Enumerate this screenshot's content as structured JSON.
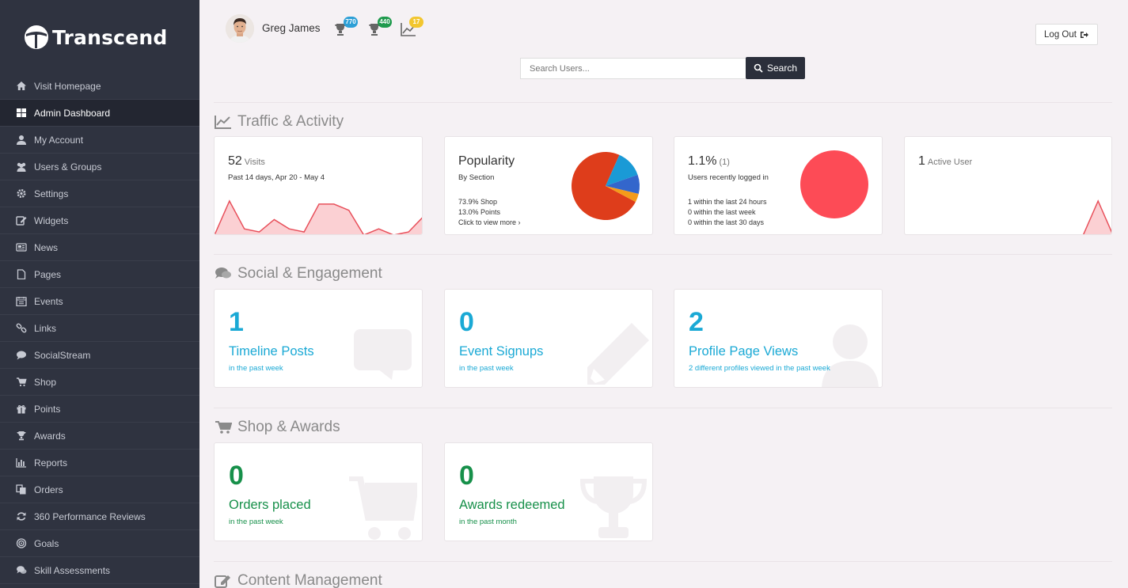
{
  "brand": {
    "name": "Transcend"
  },
  "sidebar": {
    "items": [
      {
        "label": "Visit Homepage",
        "icon": "home-icon"
      },
      {
        "label": "Admin Dashboard",
        "icon": "dashboard-icon",
        "active": true
      },
      {
        "label": "My Account",
        "icon": "user-icon"
      },
      {
        "label": "Users & Groups",
        "icon": "users-icon"
      },
      {
        "label": "Settings",
        "icon": "gear-icon"
      },
      {
        "label": "Widgets",
        "icon": "edit-icon"
      },
      {
        "label": "News",
        "icon": "newspaper-icon"
      },
      {
        "label": "Pages",
        "icon": "file-icon"
      },
      {
        "label": "Events",
        "icon": "calendar-icon"
      },
      {
        "label": "Links",
        "icon": "link-icon"
      },
      {
        "label": "SocialStream",
        "icon": "comment-icon"
      },
      {
        "label": "Shop",
        "icon": "cart-icon"
      },
      {
        "label": "Points",
        "icon": "gift-icon"
      },
      {
        "label": "Awards",
        "icon": "trophy-icon"
      },
      {
        "label": "Reports",
        "icon": "bar-chart-icon"
      },
      {
        "label": "Orders",
        "icon": "copy-icon"
      },
      {
        "label": "360 Performance Reviews",
        "icon": "refresh-icon"
      },
      {
        "label": "Goals",
        "icon": "bullseye-icon"
      },
      {
        "label": "Skill Assessments",
        "icon": "comments-icon"
      }
    ]
  },
  "header": {
    "user_name": "Greg James",
    "badges": [
      {
        "icon": "trophy-icon",
        "count": "770",
        "color": "#2c9fd6"
      },
      {
        "icon": "trophy-icon",
        "count": "440",
        "color": "#1f9a4d"
      },
      {
        "icon": "line-chart-icon",
        "count": "17",
        "color": "#f2c62f"
      }
    ],
    "logout_label": "Log Out",
    "search_placeholder": "Search Users...",
    "search_button": "Search"
  },
  "sections": {
    "traffic": "Traffic & Activity",
    "social": "Social & Engagement",
    "shop": "Shop & Awards",
    "content": "Content Management"
  },
  "traffic": {
    "visits": {
      "count": "52",
      "unit": "Visits",
      "subtitle": "Past 14 days, Apr 20 - May 4"
    },
    "popularity": {
      "title": "Popularity",
      "subtitle": "By Section",
      "line1": "73.9% Shop",
      "line2": "13.0% Points",
      "link": "Click to view more ›"
    },
    "logins": {
      "pct": "1.1%",
      "count": "(1)",
      "subtitle": "Users recently logged in",
      "line1": "1 within the last 24 hours",
      "line2": "0 within the last week",
      "line3": "0 within the last 30 days"
    },
    "active": {
      "count": "1",
      "unit": "Active User"
    }
  },
  "chart_data": [
    {
      "type": "area",
      "title": "",
      "values": [
        0,
        11,
        2,
        1,
        5,
        2,
        1,
        10,
        10,
        8,
        0,
        2,
        0,
        1,
        6
      ],
      "color": "#e8505b"
    },
    {
      "type": "pie",
      "labels": [
        "Shop",
        "Points",
        "",
        ""
      ],
      "values": [
        73.9,
        13.0,
        9.1,
        4.0
      ],
      "colors": [
        "#de3d1b",
        "#1a9ad6",
        "#3366cc",
        "#f49b1a"
      ]
    },
    {
      "type": "pie",
      "values": [
        100
      ],
      "colors": [
        "#fd4b56"
      ]
    },
    {
      "type": "area",
      "values": [
        0,
        0,
        0,
        0,
        0,
        0,
        0,
        0,
        0,
        0,
        0,
        0,
        0,
        1,
        0
      ],
      "color": "#e8505b"
    }
  ],
  "social": [
    {
      "num": "1",
      "label": "Timeline Posts",
      "sub": "in the past week",
      "icon": "comment-bg-icon"
    },
    {
      "num": "0",
      "label": "Event Signups",
      "sub": "in the past week",
      "icon": "pencil-bg-icon"
    },
    {
      "num": "2",
      "label": "Profile Page Views",
      "sub": "2 different profiles viewed in the past week",
      "icon": "user-bg-icon"
    }
  ],
  "shop": [
    {
      "num": "0",
      "label": "Orders placed",
      "sub": "in the past week",
      "icon": "cart-bg-icon"
    },
    {
      "num": "0",
      "label": "Awards redeemed",
      "sub": "in the past month",
      "icon": "trophy-bg-icon"
    }
  ]
}
